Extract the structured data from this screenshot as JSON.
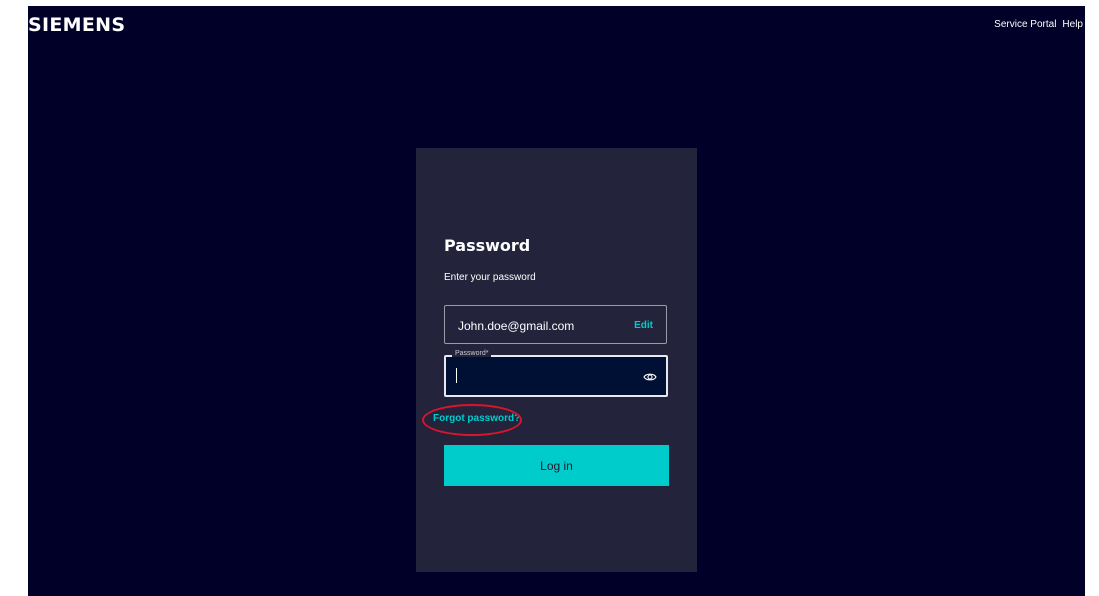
{
  "header": {
    "logo_text": "SIEMENS",
    "links": [
      "Service Portal",
      "Help"
    ]
  },
  "card": {
    "title": "Password",
    "subtitle": "Enter your password",
    "email_value": "John.doe@gmail.com",
    "edit_label": "Edit",
    "password_label": "Password*",
    "password_value": "",
    "forgot_label": "Forgot password?",
    "login_label": "Log in"
  },
  "colors": {
    "background": "#000028",
    "card": "#23233c",
    "accent": "#00cccc",
    "highlight": "#d8152a"
  },
  "icons": {
    "password_toggle": "eye-icon"
  }
}
